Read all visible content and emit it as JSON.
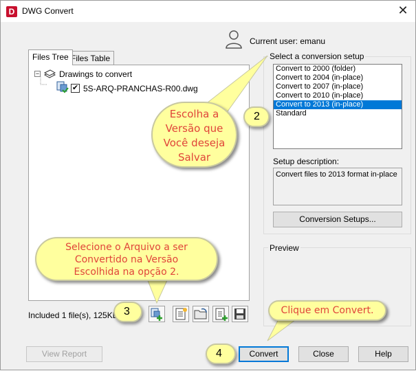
{
  "window": {
    "title": "DWG Convert",
    "close_glyph": "✕"
  },
  "user": {
    "label": "Current user: emanu",
    "icon": "user-icon"
  },
  "tabs": [
    {
      "label": "Files Tree",
      "active": true
    },
    {
      "label": "Files Table",
      "active": false
    }
  ],
  "tree": {
    "root_label": "Drawings to convert",
    "file_label": "5S-ARQ-PRANCHAS-R00.dwg",
    "file_checked": true,
    "expander": "−",
    "check_glyph": "✔"
  },
  "included_text": "Included 1 file(s), 125KB",
  "toolbar_icons": [
    "add-file-icon",
    "new-sheet-icon",
    "open-folder-icon",
    "list-icon",
    "save-icon"
  ],
  "setup": {
    "group_label": "Select a conversion setup",
    "items": [
      "Convert to 2000 (folder)",
      "Convert to 2004 (in-place)",
      "Convert to 2007 (in-place)",
      "Convert to 2010 (in-place)",
      "Convert to 2013 (in-place)",
      "Standard"
    ],
    "selected_index": 4,
    "description_label": "Setup description:",
    "description": "Convert files to 2013 format in-place",
    "setups_button": "Conversion Setups..."
  },
  "preview": {
    "label": "Preview"
  },
  "buttons": {
    "view_report": "View Report",
    "convert": "Convert",
    "close": "Close",
    "help": "Help"
  },
  "annotations": {
    "callout_version": [
      "Escolha a",
      "Versão que",
      "Você deseja",
      "Salvar"
    ],
    "callout_file": [
      "Selecione o Arquivo a ser",
      "Convertido na Versão",
      "Escolhida na opção 2."
    ],
    "callout_convert": "Clique em Convert.",
    "badges": [
      "2",
      "3",
      "4"
    ]
  },
  "colors": {
    "callout_text": "#e0443a",
    "callout_fill": "#ffff9e",
    "selection": "#0078d7"
  }
}
